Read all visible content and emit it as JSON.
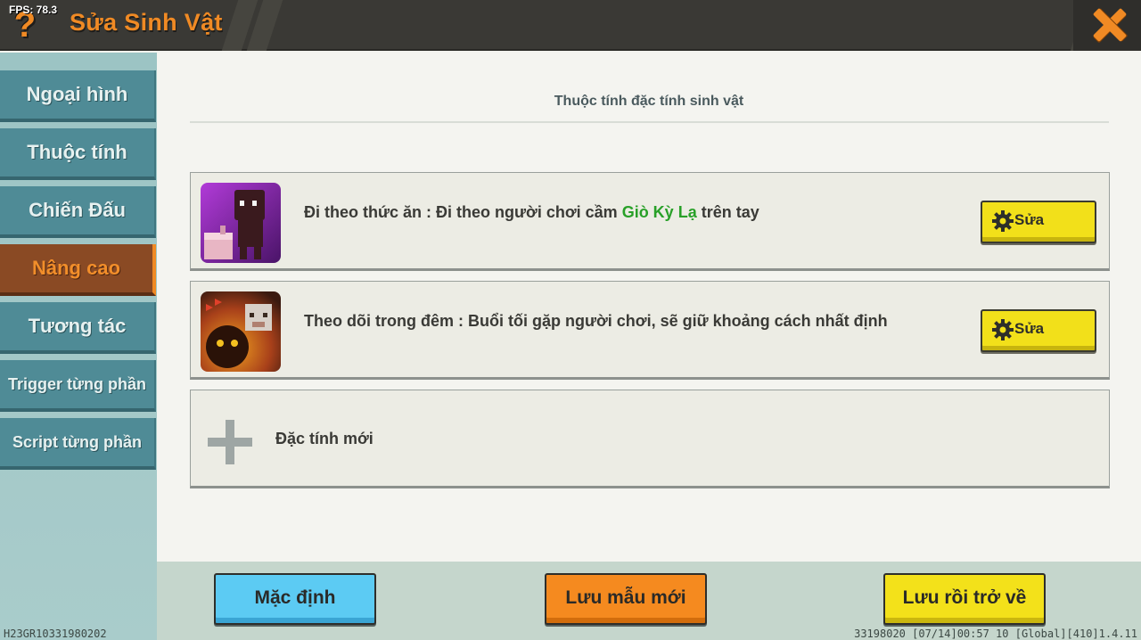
{
  "header": {
    "fps": "FPS: 78.3",
    "help_glyph": "?",
    "title": "Sửa Sinh Vật",
    "close_icon": "close-x-icon",
    "accent": "#f08a24"
  },
  "sidebar": {
    "items": [
      {
        "label": "Ngoại hình"
      },
      {
        "label": "Thuộc tính"
      },
      {
        "label": "Chiến Đấu"
      },
      {
        "label": "Nâng cao",
        "active": true
      },
      {
        "label": "Tương tác"
      },
      {
        "label": "Trigger từng phần"
      },
      {
        "label": "Script từng phần"
      }
    ]
  },
  "main": {
    "section_title": "Thuộc tính đặc tính sinh vật",
    "traits": [
      {
        "text_before": "Đi theo thức ăn : Đi theo người chơi cầm ",
        "highlight": "Giò Kỳ Lạ",
        "text_after": " trên tay",
        "edit_label": "Sửa",
        "icon": "follow-food-icon"
      },
      {
        "text_before": "Theo dõi trong đêm : Buổi tối gặp người chơi, sẽ giữ khoảng cách nhất định",
        "highlight": "",
        "text_after": "",
        "edit_label": "Sửa",
        "icon": "night-watch-icon"
      }
    ],
    "add_trait_label": "Đặc tính mới"
  },
  "footer": {
    "default_label": "Mặc định",
    "save_template_label": "Lưu mẫu mới",
    "save_return_label": "Lưu rồi trở về",
    "debug_left": "H23GR10331980202",
    "debug_right": "33198020 [07/14]00:57 10 [Global][410]1.4.11"
  }
}
